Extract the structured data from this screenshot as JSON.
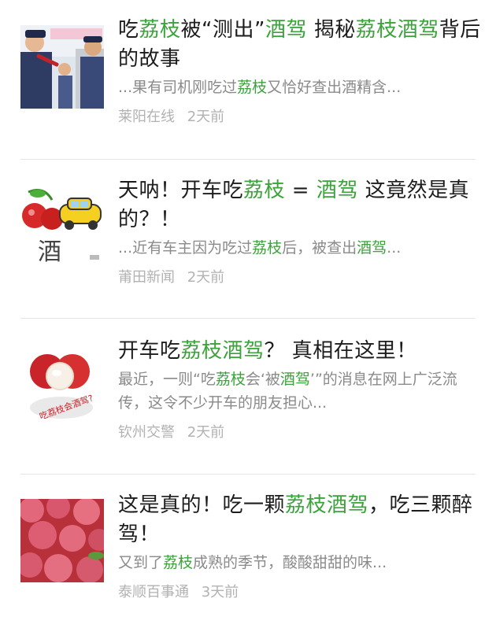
{
  "articles": [
    {
      "title_segments": [
        {
          "text": "吃",
          "hl": false
        },
        {
          "text": "荔枝",
          "hl": true
        },
        {
          "text": "被“测出”",
          "hl": false
        },
        {
          "text": "酒驾",
          "hl": true
        },
        {
          "text": " 揭秘",
          "hl": false
        },
        {
          "text": "荔枝酒驾",
          "hl": true
        },
        {
          "text": "背后的故事",
          "hl": false
        }
      ],
      "snippet_segments": [
        {
          "text": "...果有司机刚吃过",
          "hl": false
        },
        {
          "text": "荔枝",
          "hl": true
        },
        {
          "text": "又恰好查出酒精含...",
          "hl": false
        }
      ],
      "source": "莱阳在线",
      "time": "2天前",
      "thumb_icon": "police-breathalyzer-photo"
    },
    {
      "title_segments": [
        {
          "text": "天呐！开车吃",
          "hl": false
        },
        {
          "text": "荔枝",
          "hl": true
        },
        {
          "text": " = ",
          "hl": false
        },
        {
          "text": "酒驾",
          "hl": true
        },
        {
          "text": " 这竟然是真的？！",
          "hl": false
        }
      ],
      "snippet_segments": [
        {
          "text": "...近有车主因为吃过",
          "hl": false
        },
        {
          "text": "荔枝",
          "hl": true
        },
        {
          "text": "后，被查出",
          "hl": false
        },
        {
          "text": "酒驾",
          "hl": true
        },
        {
          "text": "...",
          "hl": false
        }
      ],
      "source": "莆田新闻",
      "time": "2天前",
      "thumb_icon": "lychee-car-cartoon"
    },
    {
      "title_segments": [
        {
          "text": "开车吃",
          "hl": false
        },
        {
          "text": "荔枝酒驾",
          "hl": true
        },
        {
          "text": "？ 真相在这里！",
          "hl": false
        }
      ],
      "snippet_segments": [
        {
          "text": "最近，一则“吃",
          "hl": false
        },
        {
          "text": "荔枝",
          "hl": true
        },
        {
          "text": "会‘被",
          "hl": false
        },
        {
          "text": "酒驾",
          "hl": true
        },
        {
          "text": "’”的消息在网上广泛流传，这令不少开车的朋友担心...",
          "hl": false
        }
      ],
      "source": "钦州交警",
      "time": "2天前",
      "thumb_icon": "peeled-lychee-illustration"
    },
    {
      "title_segments": [
        {
          "text": "这是真的！吃一颗",
          "hl": false
        },
        {
          "text": "荔枝酒驾",
          "hl": true
        },
        {
          "text": "，吃三颗醉驾！",
          "hl": false
        }
      ],
      "snippet_segments": [
        {
          "text": "又到了",
          "hl": false
        },
        {
          "text": "荔枝",
          "hl": true
        },
        {
          "text": "成熟的季节，酸酸甜甜的味...",
          "hl": false
        }
      ],
      "source": "泰顺百事通",
      "time": "3天前",
      "thumb_icon": "lychee-fruit-photo"
    }
  ],
  "colors": {
    "highlight": "#3aa33a",
    "title": "#1c1c1c",
    "snippet": "#8a8a8a",
    "meta": "#b2b2b2",
    "divider": "#e6e6e6"
  }
}
